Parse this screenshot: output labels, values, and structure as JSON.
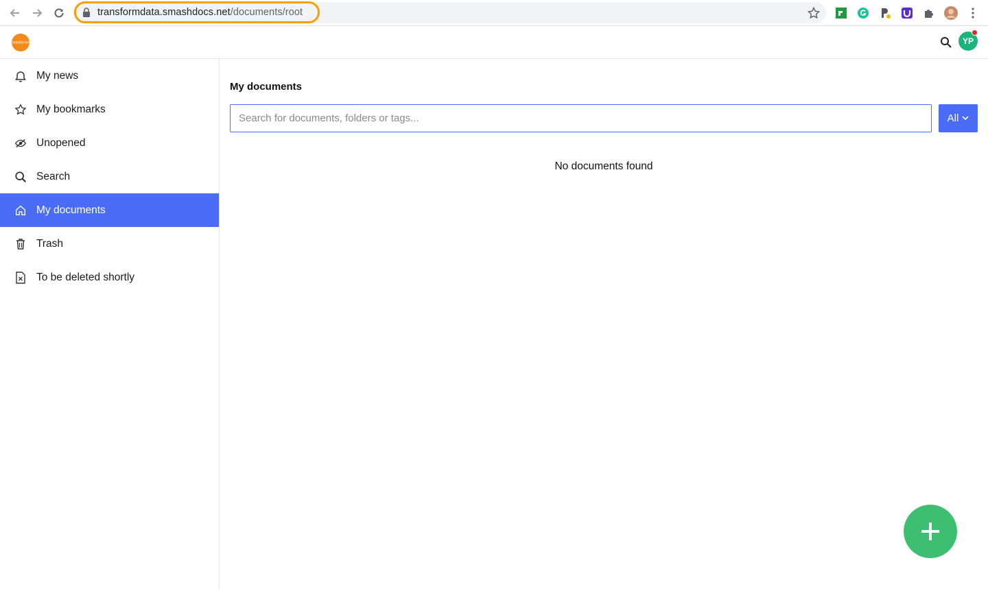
{
  "browser": {
    "url_host": "transformdata.smashdocs.net",
    "url_path": "/documents/root",
    "icons": [
      "back-arrow-icon",
      "forward-arrow-icon",
      "reload-icon",
      "lock-icon",
      "bookmark-star-icon",
      "extension-icons",
      "puzzle-icon",
      "profile-avatar-icon",
      "menu-dots-icon"
    ]
  },
  "header": {
    "logo_text": "transformdata",
    "avatar_initials": "YP",
    "accent_color": "#4a6cf7",
    "avatar_color": "#1db37a"
  },
  "sidebar": {
    "items": [
      {
        "label": "My news",
        "icon": "bell-icon"
      },
      {
        "label": "My bookmarks",
        "icon": "star-icon"
      },
      {
        "label": "Unopened",
        "icon": "eye-slash-icon"
      },
      {
        "label": "Search",
        "icon": "search-icon"
      },
      {
        "label": "My documents",
        "icon": "home-icon",
        "active": true
      },
      {
        "label": "Trash",
        "icon": "trash-icon"
      },
      {
        "label": "To be deleted shortly",
        "icon": "file-x-icon"
      }
    ]
  },
  "main": {
    "title": "My documents",
    "search": {
      "placeholder": "Search for documents, folders or tags...",
      "value": ""
    },
    "filter_label": "All",
    "empty_message": "No documents found",
    "fab_color": "#3dbf72"
  }
}
